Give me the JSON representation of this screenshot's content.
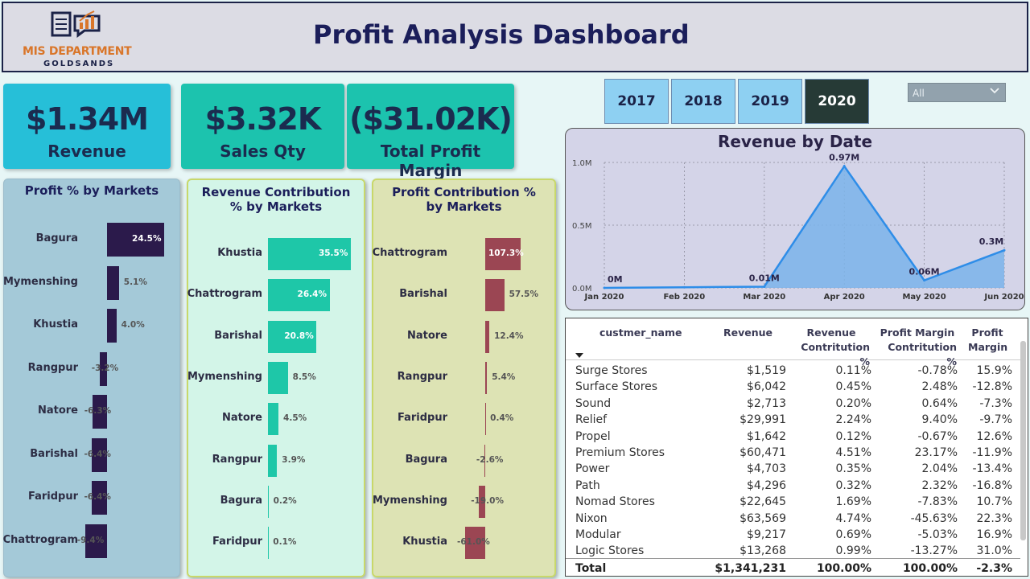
{
  "header": {
    "logo_title": "MIS DEPARTMENT",
    "logo_subtitle": "GOLDSANDS",
    "title": "Profit Analysis Dashboard"
  },
  "kpis": [
    {
      "value": "$1.34M",
      "label": "Revenue",
      "color": "#26bfd8"
    },
    {
      "value": "$3.32K",
      "label": "Sales Qty",
      "color": "#1cc3ae"
    },
    {
      "value": "($31.02K)",
      "label": "Total Profit Margin",
      "color": "#1cc3ae"
    }
  ],
  "year_buttons": [
    {
      "label": "2017",
      "active": false
    },
    {
      "label": "2018",
      "active": false
    },
    {
      "label": "2019",
      "active": false
    },
    {
      "label": "2020",
      "active": true
    }
  ],
  "filter": {
    "selected": "All"
  },
  "profit_markets": {
    "title": "Profit % by Markets",
    "bar_color": "#2b1a4b",
    "bg": "#a4c9d8",
    "rows": [
      {
        "label": "Bagura",
        "value": 24.5,
        "text": "24.5%"
      },
      {
        "label": "Mymenshing",
        "value": 5.1,
        "text": "5.1%"
      },
      {
        "label": "Khustia",
        "value": 4.0,
        "text": "4.0%"
      },
      {
        "label": "Rangpur",
        "value": -3.2,
        "text": "-3.2%"
      },
      {
        "label": "Natore",
        "value": -6.3,
        "text": "-6.3%"
      },
      {
        "label": "Barishal",
        "value": -6.4,
        "text": "-6.4%"
      },
      {
        "label": "Faridpur",
        "value": -6.4,
        "text": "-6.4%"
      },
      {
        "label": "Chattrogram",
        "value": -9.4,
        "text": "-9.4%"
      }
    ]
  },
  "revenue_markets": {
    "title": "Revenue Contribution % by Markets",
    "bar_color": "#1ec7a8",
    "bg": "#d3f5e8",
    "rows": [
      {
        "label": "Khustia",
        "value": 35.5,
        "text": "35.5%"
      },
      {
        "label": "Chattrogram",
        "value": 26.4,
        "text": "26.4%"
      },
      {
        "label": "Barishal",
        "value": 20.8,
        "text": "20.8%"
      },
      {
        "label": "Mymenshing",
        "value": 8.5,
        "text": "8.5%"
      },
      {
        "label": "Natore",
        "value": 4.5,
        "text": "4.5%"
      },
      {
        "label": "Rangpur",
        "value": 3.9,
        "text": "3.9%"
      },
      {
        "label": "Bagura",
        "value": 0.2,
        "text": "0.2%"
      },
      {
        "label": "Faridpur",
        "value": 0.1,
        "text": "0.1%"
      }
    ]
  },
  "profit_contrib_markets": {
    "title": "Profit Contribution % by Markets",
    "bar_color": "#9b4653",
    "bg": "#dde3b4",
    "rows": [
      {
        "label": "Chattrogram",
        "value": 107.3,
        "text": "107.3%"
      },
      {
        "label": "Barishal",
        "value": 57.5,
        "text": "57.5%"
      },
      {
        "label": "Natore",
        "value": 12.4,
        "text": "12.4%"
      },
      {
        "label": "Rangpur",
        "value": 5.4,
        "text": "5.4%"
      },
      {
        "label": "Faridpur",
        "value": 0.4,
        "text": "0.4%"
      },
      {
        "label": "Bagura",
        "value": -2.6,
        "text": "-2.6%"
      },
      {
        "label": "Mymenshing",
        "value": -19.0,
        "text": "-19.0%"
      },
      {
        "label": "Khustia",
        "value": -61.0,
        "text": "-61.0%"
      }
    ]
  },
  "chart_data": {
    "type": "area",
    "title": "Revenue by Date",
    "x": [
      "Jan 2020",
      "Feb 2020",
      "Mar 2020",
      "Apr 2020",
      "May 2020",
      "Jun 2020"
    ],
    "values": [
      0.0,
      0.005,
      0.01,
      0.97,
      0.06,
      0.3
    ],
    "data_labels": [
      "0M",
      "",
      "0.01M",
      "0.97M",
      "0.06M",
      "0.3M"
    ],
    "yticks": [
      "0.0M",
      "0.5M",
      "1.0M"
    ],
    "ylim": [
      0,
      1.0
    ],
    "color": "#2e8de8",
    "grid": true
  },
  "table": {
    "headers": {
      "name": "custmer_name",
      "revenue": "Revenue",
      "rev_contrib_1": "Revenue",
      "rev_contrib_2": "Contritution %",
      "profit_contrib_1": "Profit Margin",
      "profit_contrib_2": "Contritution %",
      "margin_1": "Profit",
      "margin_2": "Margin"
    },
    "rows": [
      {
        "name": "Surge Stores",
        "revenue": "$1,519",
        "rev": "0.11%",
        "pc": "-0.78%",
        "pm": "15.9%"
      },
      {
        "name": "Surface Stores",
        "revenue": "$6,042",
        "rev": "0.45%",
        "pc": "2.48%",
        "pm": "-12.8%"
      },
      {
        "name": "Sound",
        "revenue": "$2,713",
        "rev": "0.20%",
        "pc": "0.64%",
        "pm": "-7.3%"
      },
      {
        "name": "Relief",
        "revenue": "$29,991",
        "rev": "2.24%",
        "pc": "9.40%",
        "pm": "-9.7%"
      },
      {
        "name": "Propel",
        "revenue": "$1,642",
        "rev": "0.12%",
        "pc": "-0.67%",
        "pm": "12.6%"
      },
      {
        "name": "Premium Stores",
        "revenue": "$60,471",
        "rev": "4.51%",
        "pc": "23.17%",
        "pm": "-11.9%"
      },
      {
        "name": "Power",
        "revenue": "$4,703",
        "rev": "0.35%",
        "pc": "2.04%",
        "pm": "-13.4%"
      },
      {
        "name": "Path",
        "revenue": "$4,296",
        "rev": "0.32%",
        "pc": "2.32%",
        "pm": "-16.8%"
      },
      {
        "name": "Nomad Stores",
        "revenue": "$22,645",
        "rev": "1.69%",
        "pc": "-7.83%",
        "pm": "10.7%"
      },
      {
        "name": "Nixon",
        "revenue": "$63,569",
        "rev": "4.74%",
        "pc": "-45.63%",
        "pm": "22.3%"
      },
      {
        "name": "Modular",
        "revenue": "$9,217",
        "rev": "0.69%",
        "pc": "-5.03%",
        "pm": "16.9%"
      },
      {
        "name": "Logic Stores",
        "revenue": "$13,268",
        "rev": "0.99%",
        "pc": "-13.27%",
        "pm": "31.0%"
      }
    ],
    "total": {
      "name": "Total",
      "revenue": "$1,341,231",
      "rev": "100.00%",
      "pc": "100.00%",
      "pm": "-2.3%"
    }
  }
}
